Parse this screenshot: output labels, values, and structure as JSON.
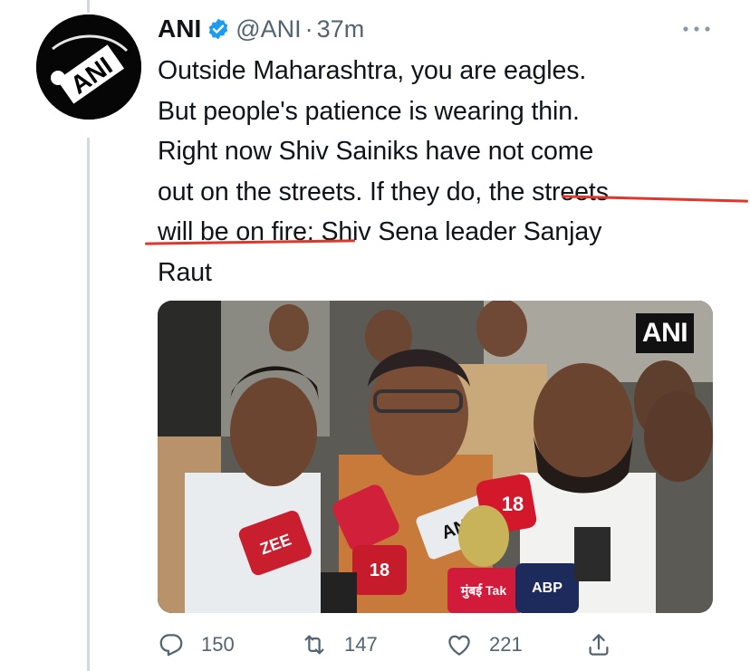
{
  "tweet": {
    "author_name": "ANI",
    "handle": "@ANI",
    "separator": "·",
    "time": "37m",
    "lines": [
      "Outside Maharashtra, you are eagles.",
      "But people's patience is wearing thin.",
      "Right now Shiv Sainiks have not come",
      "out on the streets. If they do, the streets",
      "will be on fire: Shiv Sena leader Sanjay",
      "Raut"
    ],
    "avatar_text": "ANI",
    "media_watermark": "ANI",
    "mic_labels": [
      "ANI",
      "18",
      "ZEE",
      "18",
      "मुंबई Tak",
      "ABP"
    ]
  },
  "actions": {
    "replies": "150",
    "retweets": "147",
    "likes": "221"
  },
  "colors": {
    "text": "#0f1419",
    "secondary": "#536471",
    "verified": "#1d9bf0",
    "underline": "#e0362c"
  }
}
